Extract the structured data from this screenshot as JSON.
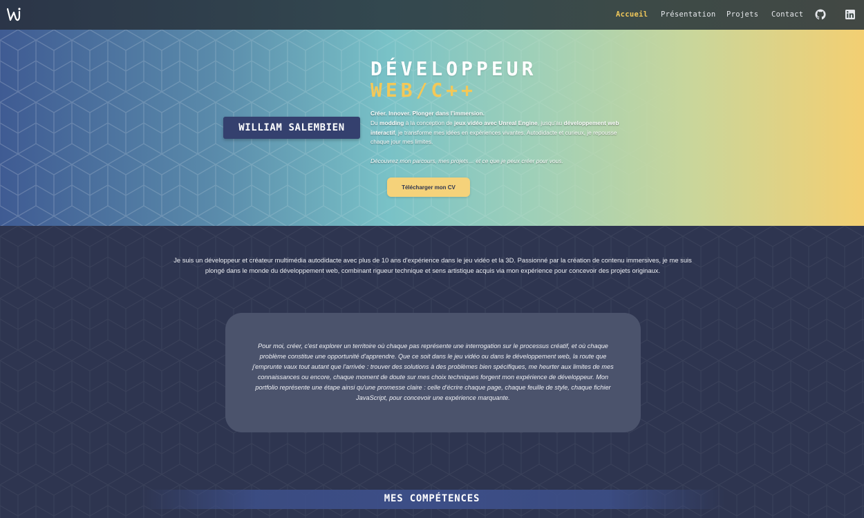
{
  "nav": {
    "logo": "logo-icon",
    "items": [
      {
        "label": "Accueil",
        "active": true
      },
      {
        "label": "Présentation",
        "active": false
      },
      {
        "label": "Projets",
        "active": false
      },
      {
        "label": "Contact",
        "active": false
      }
    ],
    "icons": [
      "github-icon",
      "linkedin-icon"
    ]
  },
  "hero": {
    "name": "WILLIAM SALEMBIEN",
    "title_line1": "DÉVELOPPEUR",
    "title_line2": "WEB/C++",
    "tagline": "Créer. Innover. Plonger dans l'immersion.",
    "desc_1": "Du ",
    "desc_b1": "modding",
    "desc_2": " à la conception de ",
    "desc_b2": "jeux vidéo avec Unreal Engine",
    "desc_3": ", jusqu'au ",
    "desc_b3": "développement web interactif",
    "desc_4": ", je transforme mes idées en expériences vivantes. Autodidacte et curieux, je repousse chaque jour mes limites.",
    "invite": "Découvrez mon parcours, mes projets… et ce que je peux créer pour vous.",
    "cv_button": "Télécharger mon CV"
  },
  "intro": "Je suis un développeur et créateur multimédia autodidacte avec plus de 10 ans d'expérience dans le jeu vidéo et la 3D. Passionné par la création de contenu immersives, je me suis plongé dans le monde du développement web, combinant rigueur technique et sens artistique acquis via mon expérience pour concevoir des projets originaux.",
  "quote": "Pour moi, créer, c'est explorer un territoire où chaque pas représente une interrogation sur le processus créatif, et où chaque problème constitue une opportunité d'apprendre. Que ce soit dans le jeu vidéo ou dans le développement web, la route que j'emprunte vaux tout autant que l'arrivée : trouver des solutions à des problèmes bien spécifiques, me heurter aux limites de mes connaissances ou encore, chaque moment de doute sur mes choix techniques forgent mon expérience de développeur. Mon portfolio représente une étape ainsi qu'une promesse claire : celle d'écrire chaque page, chaque feuille de style, chaque fichier JavaScript, pour concevoir une expérience marquante.",
  "skills_title": "MES COMPÉTENCES",
  "colors": {
    "accent": "#f1c85a",
    "background": "#2e3550",
    "badge": "#34406e",
    "card": "#4b536c",
    "button": "#f5d27a"
  }
}
